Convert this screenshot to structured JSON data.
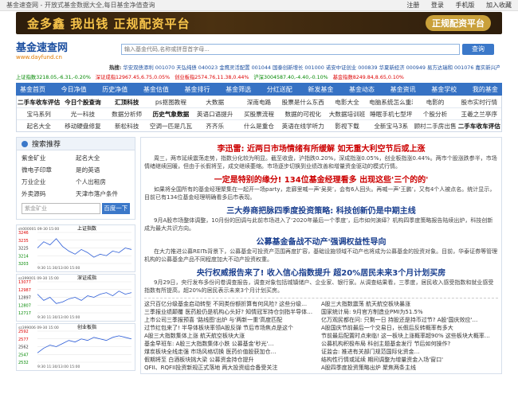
{
  "topbar": {
    "tagline": "基金速查网 - 开放式基金数据大全,每日基金净值查询",
    "links": [
      "注册",
      "登录",
      "手机版",
      "加入收藏"
    ]
  },
  "banner": {
    "slogan": "金多鑫  我出钱  正规配资平台",
    "cta": "正规配资平台"
  },
  "header": {
    "logo_cn": "基金速查网",
    "logo_en": "www.dayfund.cn",
    "search_placeholder": "输入基金代码,名称或拼音首字母...",
    "search_button": "查询"
  },
  "hot": {
    "label": "热搜:",
    "text": "华安双债添利 001070 天弘纯债 040023 金鹰灵活配置 001044 国泰创新增长 001000 诺安中证创业 000839 华夏新经济 000949 易方达瑞和 001076 嘉实新兴产业 000751 南方理财"
  },
  "ticker": {
    "items": [
      {
        "t": "上证指数3218.05,-6.31,-0.20%",
        "c": "dn"
      },
      {
        "t": "深证成指12967.45,6.75,0.05%",
        "c": "up"
      },
      {
        "t": "创业板指2574.76,11.38,0.44%",
        "c": "up"
      },
      {
        "t": "沪深3004587.40,-4.40,-0.10%",
        "c": "dn"
      },
      {
        "t": "基金指数8249.84,8.65,0.10%",
        "c": "up"
      }
    ]
  },
  "nav": [
    "基金首页",
    "今日净值",
    "历史净值",
    "基金估值",
    "基金排行",
    "基金筛选",
    "分红送配",
    "新发基金",
    "基金动态",
    "基金资讯",
    "基金学校",
    "我的基金"
  ],
  "subnav": [
    [
      "二手车收车评估",
      "今日个股查询",
      "汇顶科技",
      "ps抠图教程",
      "大数据",
      "深南电路",
      "股票是什么东西",
      "电影大全",
      "电脑系统怎么重装",
      "电影的",
      "股市实时行情"
    ],
    [
      "宝马系列",
      "光一科技",
      "数据分析师",
      "历史气象数据",
      "英语口语提升",
      "买股票流程",
      "数据的可视化",
      "大数据培训班",
      "睡眠手机七型坪",
      "个股分析",
      "王羲之兰亭序"
    ],
    [
      "起名大全",
      "移动硬盘修复",
      "新松科技",
      "空调一匹是几瓦",
      "齐齐乐",
      "什么是重仓",
      "英语在线学听力",
      "影视下载",
      "全新宝马3系",
      "顾村二手房出售",
      "二手车收车评估"
    ]
  ],
  "highlight": [
    "今日个股查询",
    "汇顶科技",
    "历史气象数据",
    "二手车收车评估"
  ],
  "side": {
    "search_title": "搜索推荐",
    "recs": [
      "紫金矿业",
      "起名大全",
      "微电子印章",
      "是的英语",
      "万业企业",
      "个人出租房",
      "外卖源码",
      "天津市落户条件"
    ],
    "search_value": "紫金矿业",
    "search_btn": "百度一下",
    "charts": [
      {
        "title": "上证指数",
        "sub": "sh000001   09-30 15:00",
        "ylabels": [
          "3246",
          "3235",
          "3225",
          "3214",
          "3203"
        ],
        "time": "9:30   11:30/13:00   15:00",
        "values": [
          0.5,
          0.7,
          0.6,
          0.8,
          0.55,
          0.4,
          0.3,
          0.45,
          0.35,
          0.2,
          0.3,
          0.25,
          0.4,
          0.35,
          0.5,
          0.45
        ]
      },
      {
        "title": "深证成指",
        "sub": "sz399001   09-30 15:00",
        "ylabels": [
          "13077",
          "12987",
          "12897",
          "12807",
          "12717"
        ],
        "time": "9:30   11:30/13:00   15:00",
        "values": [
          0.6,
          0.4,
          0.5,
          0.3,
          0.35,
          0.45,
          0.5,
          0.4,
          0.55,
          0.5,
          0.6,
          0.65,
          0.55,
          0.7,
          0.6,
          0.65
        ]
      },
      {
        "title": "创业板指",
        "sub": "sz399006   09-30 15:00",
        "ylabels": [
          "2592",
          "2577",
          "2562",
          "2547",
          "2532"
        ],
        "time": "9:30   11:30/13:00   15:00",
        "values": [
          0.3,
          0.45,
          0.55,
          0.5,
          0.6,
          0.7,
          0.65,
          0.75,
          0.7,
          0.8,
          0.75,
          0.7,
          0.8,
          0.85,
          0.8,
          0.75
        ]
      }
    ]
  },
  "news": [
    {
      "h": "李迅雷: 近两日市场情绪有所缓解 如无重大利空节后或上涨",
      "red": true,
      "p": "周三，两市延续震荡走势，指数分化较为明显。截至收盘，沪指跌0.20%，深成指涨0.05%，创业板指涨0.44%。两市个股涨跌参半，市场情绪继续回暖，但由于长假将至，成交继续萎缩。市场逐步切换到业绩改善和增量资金驱动的模式行情。"
    },
    {
      "h": "一定是特别的缘分! 134位基金经理看多 出现这些'三个的的'",
      "red": true,
      "p": "如果将全国所有的基金经理聚集在一起开一场party，走廊里喊一声‘吴昊’，会有6人回头。再喊一声‘王鹏’，又有4个人被点名。统计显示，目前已有134位基金经理明确看多后市表现。"
    },
    {
      "h": "三大券商把脉四季度投资策略: 科技创新仍是中期主线",
      "red": false,
      "p": "9月A股市场整体调整，10月份的回调与此前市场进入了‘2020年最后一个季度’，后市如何演绎？机构四季度策略报告陆续出炉，科技创新成为最大共识方向。"
    },
    {
      "h": "公募基金备战不动产'强调权益性导向",
      "red": false,
      "p": "在大力推进公募REITs背景下，公募基金可投资产范围再度扩容，基础设施领域不动产也将成为公募基金的投资对象。目前，华泰证券等管理机构的公募基金产品不同程度加大不动产投资权重。"
    },
    {
      "h": "央行权威报告来了! 收入信心指数提升 超20%居民未来3个月计划买房",
      "red": false,
      "p": "9月29日，央行发布多份问卷调查报告，调查对象包括城镇储户、企业家、银行家。从调查结果看，三季度，居民收入感受指数和就业感受指数有所提高，超20%的居民表示未来3个月计划买房。"
    }
  ],
  "lists": {
    "left": [
      "这只百亿分级基金启动转型 不同类份额折算有何风险? 这些分级…",
      "三季报业绩颠覆 医药股仍是机构心头好? 知情冠军持仓剑指半导体…",
      "上市公司三季报预喜 '路线图'出炉 与'两新一重'高度匹配",
      "过节红包来了! 半导体板块率领A股反弹 节后市场焦点是这个",
      "A股三大指数集体上涨 航天航空板块大涨",
      "基金早班车: A股三大指数集体小跌 公募基金'秒光'…",
      "煤炭板块全线走强 市场风格切换 医药价值股获加仓…",
      "假期将至 白酒板块挑大梁 公募资金持仓提升",
      "QFII、RQFII投资新规正式落地 两大投资组合备受关注"
    ],
    "right": [
      "A股三大指数震荡 航天航空板块暴涨",
      "国家统计局: 9月官方制造业PMI为51.5%",
      "亿万观民都在问: 只剩一日 持股还是持币过节? A股'国庆效应'…",
      "A股国庆节前最后一个交易日，长假后反转概率有多大",
      "节前最后配置时点来临! 这一板块上涨概率超90% 这些板块大概率…",
      "公募机构积极布局 科创主题基金发行 节后如何操作?",
      "证监会: 推进有关部门规范国际化资金…",
      "结构性行情或延续 期间调整为增量资金入场'窗口'",
      "A股四季度投资策略出炉 聚焦两条主线"
    ]
  }
}
